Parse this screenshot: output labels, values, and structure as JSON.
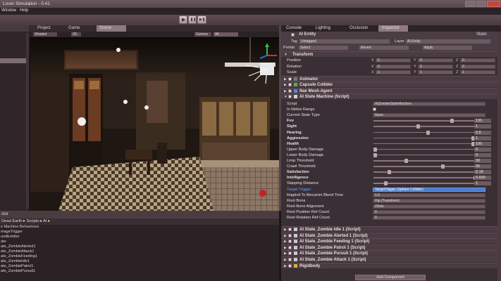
{
  "window": {
    "title": "Lover Simulation - 0.41"
  },
  "menu": {
    "items": [
      "Window",
      "Help"
    ]
  },
  "toolbar": {
    "play": "▶",
    "pause": "❚❚",
    "step": "▶❚"
  },
  "left_panel": {
    "header": ""
  },
  "view_tabs": [
    {
      "label": "Project"
    },
    {
      "label": "Game"
    },
    {
      "label": "Scene"
    }
  ],
  "view_bar": {
    "mode": "Shaded",
    "dim": "2D",
    "gizmos": "Gizmos",
    "all": "All"
  },
  "project": {
    "header": "ctor",
    "breadcrumb": "Dead Earth ▸ Scripts ▸ AI ▸",
    "items": [
      "e Machine Behaviours",
      "mageTrigger",
      "undEmitter",
      "ate",
      "ate_ZombieAlerted1",
      "ate_ZombieAttack1",
      "ate_ZombieFeeding1",
      "ate_ZombieIdle1",
      "ate_ZombiePatrol1",
      "ate_ZombiePursuit1"
    ]
  },
  "inspector": {
    "tabs": [
      "Console",
      "Lighting",
      "Occlusion",
      "Inspector"
    ],
    "object_name": "AI Entity",
    "static_label": "Static",
    "tag_label": "Tag",
    "tag_value": "Untagged",
    "layer_label": "Layer",
    "layer_value": "AI Entity",
    "prefab_label": "Prefab",
    "prefab_buttons": [
      "Select",
      "Revert",
      "Apply"
    ],
    "transform": {
      "title": "Transform",
      "rows": [
        {
          "label": "Position",
          "x": "0",
          "y": "0",
          "z": "0"
        },
        {
          "label": "Rotation",
          "x": "0",
          "y": "0",
          "z": "0"
        },
        {
          "label": "Scale",
          "x": "1",
          "y": "1",
          "z": "1"
        }
      ]
    },
    "components_top": [
      "Animator",
      "Capsule Collider",
      "Nav Mesh Agent",
      "AI State Machine (Script)"
    ],
    "state_machine": {
      "script_label": "Script",
      "script_value": "AIZombieStateMachine",
      "rows": [
        {
          "label": "In Melee Range",
          "kind": "check"
        },
        {
          "label": "Current State Type",
          "kind": "enum",
          "value": "None"
        },
        {
          "label": "Fov",
          "kind": "slider",
          "value": "135",
          "pos": 0.75,
          "bold": true
        },
        {
          "label": "Sight",
          "kind": "slider",
          "value": "1",
          "pos": 0.42,
          "bold": true
        },
        {
          "label": "Hearing",
          "kind": "slider",
          "value": "0.5",
          "pos": 0.52,
          "bold": true
        },
        {
          "label": "Aggression",
          "kind": "slider",
          "value": "1",
          "pos": 0.96,
          "bold": true
        },
        {
          "label": "Health",
          "kind": "slider",
          "value": "100",
          "pos": 0.96,
          "bold": true
        },
        {
          "label": "Upper Body Damage",
          "kind": "slider",
          "value": "0",
          "pos": 0.0
        },
        {
          "label": "Lower Body Damage",
          "kind": "slider",
          "value": "0",
          "pos": 0.0
        },
        {
          "label": "Limp Threshold",
          "kind": "slider",
          "value": "30",
          "pos": 0.3
        },
        {
          "label": "Crawl Threshold",
          "kind": "slider",
          "value": "90",
          "pos": 0.66
        },
        {
          "label": "Satisfaction",
          "kind": "slider",
          "value": "0.18",
          "pos": 0.14,
          "bold": true
        },
        {
          "label": "Intelligence",
          "kind": "slider",
          "value": "0.655",
          "pos": 0.98,
          "bold": true
        },
        {
          "label": "Slapping Distance",
          "kind": "slider",
          "value": "1",
          "pos": 0.1
        }
      ],
      "target_trigger": {
        "label": "Target Trigger",
        "value": "TargetTrigger (Sphere Collider)"
      },
      "blend": {
        "label": "Ragdoll To Mecanim Blend Time",
        "value": "1.5"
      },
      "root_bone": {
        "label": "Root Bone",
        "value": "Hip (Transform)"
      },
      "root_align": {
        "label": "Root Bone Alignment",
        "value": "ZAxis"
      },
      "ref_pos": {
        "label": "Root Position Ref Count",
        "value": "0"
      },
      "ref_rot": {
        "label": "Root Rotation Ref Count",
        "value": "0"
      }
    },
    "components_bottom": [
      "AI State_Zombie Idle 1 (Script)",
      "AI State_Zombie Alerted 1 (Script)",
      "AI State_Zombie Feeding 1 (Script)",
      "AI State_Zombie Patrol 1 (Script)",
      "AI State_Zombie Pursuit 1 (Script)",
      "AI State_Zombie Attack 1 (Script)",
      "Rigidbody"
    ],
    "add_component": "Add Component"
  },
  "colors": {
    "accent": "#4a7fd0",
    "panel": "#3a2f34",
    "header": "#4a3c42"
  }
}
